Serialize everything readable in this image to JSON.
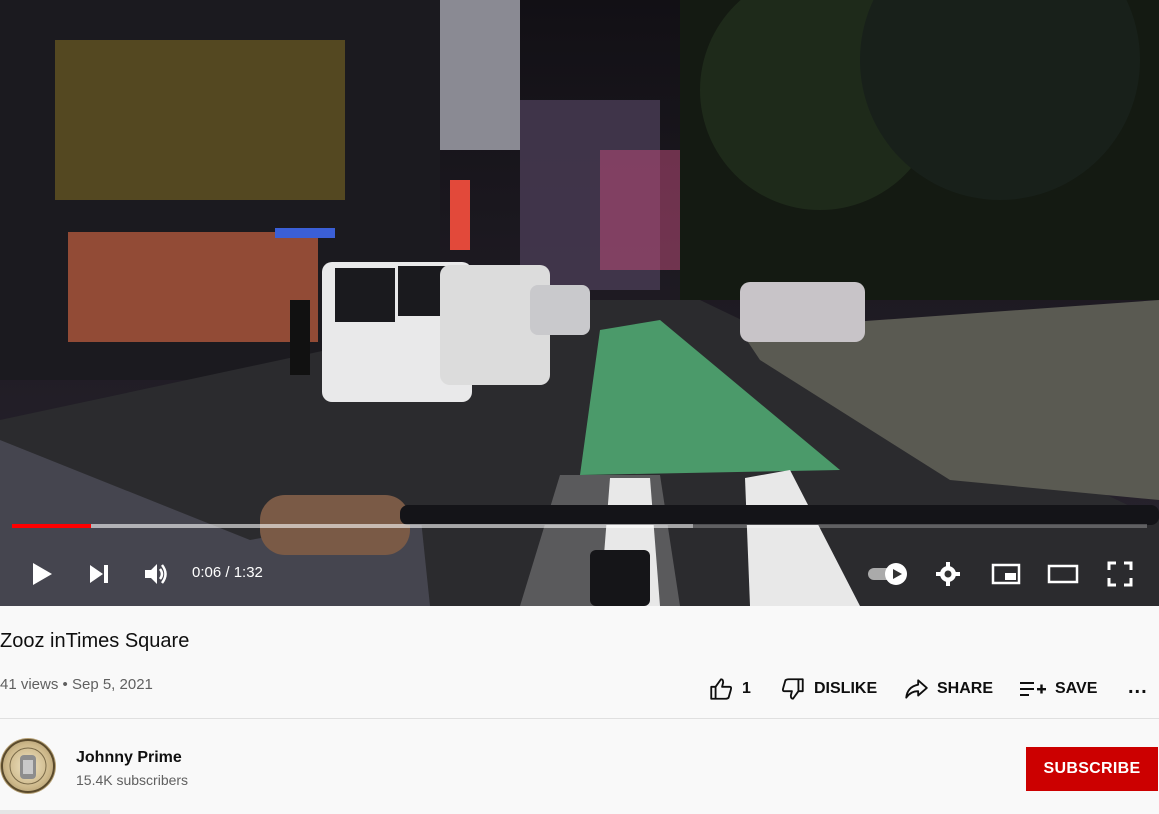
{
  "player": {
    "time_display": "0:06 / 1:32",
    "progress_played": 0.07,
    "progress_loaded": 0.6,
    "accent_color": "#ff0000",
    "controls": [
      "play-icon",
      "next-icon",
      "volume-icon",
      "autoplay-toggle",
      "settings-icon",
      "miniplayer-icon",
      "theater-icon",
      "fullscreen-icon"
    ]
  },
  "video": {
    "title": "Zooz inTimes Square",
    "views": "41 views",
    "separator": "•",
    "date": "Sep 5, 2021"
  },
  "actions": {
    "like_count": "1",
    "dislike_label": "DISLIKE",
    "share_label": "SHARE",
    "save_label": "SAVE",
    "more_label": "..."
  },
  "channel": {
    "name": "Johnny Prime",
    "subscribers": "15.4K subscribers",
    "subscribe_label": "SUBSCRIBE",
    "subscribe_color": "#cc0000"
  }
}
